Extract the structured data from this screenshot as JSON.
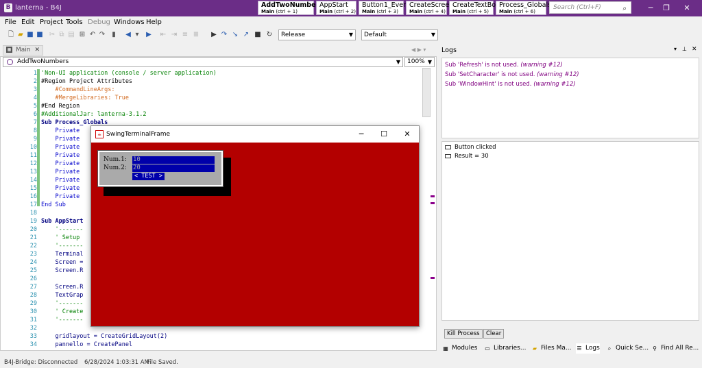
{
  "app": {
    "title": "lanterna - B4J",
    "icon": "B"
  },
  "quick_tabs": [
    {
      "name": "AddTwoNumbers",
      "module": "Main",
      "shortcut": "(ctrl + 1)"
    },
    {
      "name": "AppStart",
      "module": "Main",
      "shortcut": "(ctrl + 2)"
    },
    {
      "name": "Button1_Event",
      "module": "Main",
      "shortcut": "(ctrl + 3)"
    },
    {
      "name": "CreateScreen",
      "module": "Main",
      "shortcut": "(ctrl + 4)"
    },
    {
      "name": "CreateTextBox",
      "module": "Main",
      "shortcut": "(ctrl + 5)"
    },
    {
      "name": "Process_Globals",
      "module": "Main",
      "shortcut": "(ctrl + 6)"
    }
  ],
  "search": {
    "placeholder": "Search (Ctrl+F)"
  },
  "menu": [
    "File",
    "Edit",
    "Project",
    "Tools",
    "Debug",
    "Windows",
    "Help"
  ],
  "toolbar": {
    "build_config": "Release",
    "platform": "Default"
  },
  "editor": {
    "doc_tab": "Main",
    "sub_selector": "AddTwoNumbers",
    "zoom": "100%",
    "line_numbers": [
      "1",
      "2",
      "3",
      "4",
      "5",
      "6",
      "7",
      "8",
      "9",
      "10",
      "11",
      "12",
      "13",
      "14",
      "15",
      "16",
      "17",
      "18",
      "19",
      "20",
      "21",
      "22",
      "23",
      "24",
      "25",
      "26",
      "27",
      "28",
      "29",
      "30",
      "31",
      "32",
      "33",
      "34"
    ],
    "lines": [
      "'Non-UI application (console / server application)",
      "#Region Project Attributes",
      "    #CommandLineArgs:",
      "    #MergeLibraries: True",
      "#End Region",
      "#AdditionalJar: lanterna-3.1.2",
      "Sub Process_Globals",
      "    Private",
      "    Private",
      "    Private",
      "    Private",
      "    Private",
      "    Private",
      "    Private",
      "    Private",
      "    Private",
      "End Sub",
      "",
      "Sub AppStart",
      "    '-------",
      "    ' Setup",
      "    '-------",
      "    Terminal",
      "    Screen =",
      "    Screen.R",
      "",
      "    Screen.R",
      "    TextGrap",
      "    '-------",
      "    ' Create",
      "    '-------",
      "",
      "    gridlayout = CreateGridLayout(2)",
      "    pannello = CreatePanel"
    ]
  },
  "swing": {
    "title": "SwingTerminalFrame",
    "num1_label": "Num.1:",
    "num1_value": "10",
    "num2_label": "Num.2:",
    "num2_value": "20",
    "button": "< TEST >"
  },
  "logs": {
    "title": "Logs",
    "warnings": [
      {
        "text": "Sub 'Refresh' is not used.",
        "code": "(warning #12)"
      },
      {
        "text": "Sub 'SetCharacter' is not used.",
        "code": "(warning #12)"
      },
      {
        "text": "Sub 'WindowHint' is not used.",
        "code": "(warning #12)"
      }
    ],
    "output": [
      "Button clicked",
      "Result = 30"
    ],
    "kill_button": "Kill Process",
    "clear_button": "Clear"
  },
  "bottom_tabs": [
    "Modules",
    "Libraries...",
    "Files Ma...",
    "Logs",
    "Quick Se...",
    "Find All Re..."
  ],
  "status": {
    "bridge": "B4J-Bridge: Disconnected",
    "datetime": "6/28/2024 1:03:31 AM",
    "message": "File Saved."
  },
  "colors": {
    "titlebar": "#6b2d87",
    "terminal_bg": "#b30000",
    "field_bg": "#0000aa",
    "panel": "#aaaaaa",
    "warning": "#800080"
  }
}
